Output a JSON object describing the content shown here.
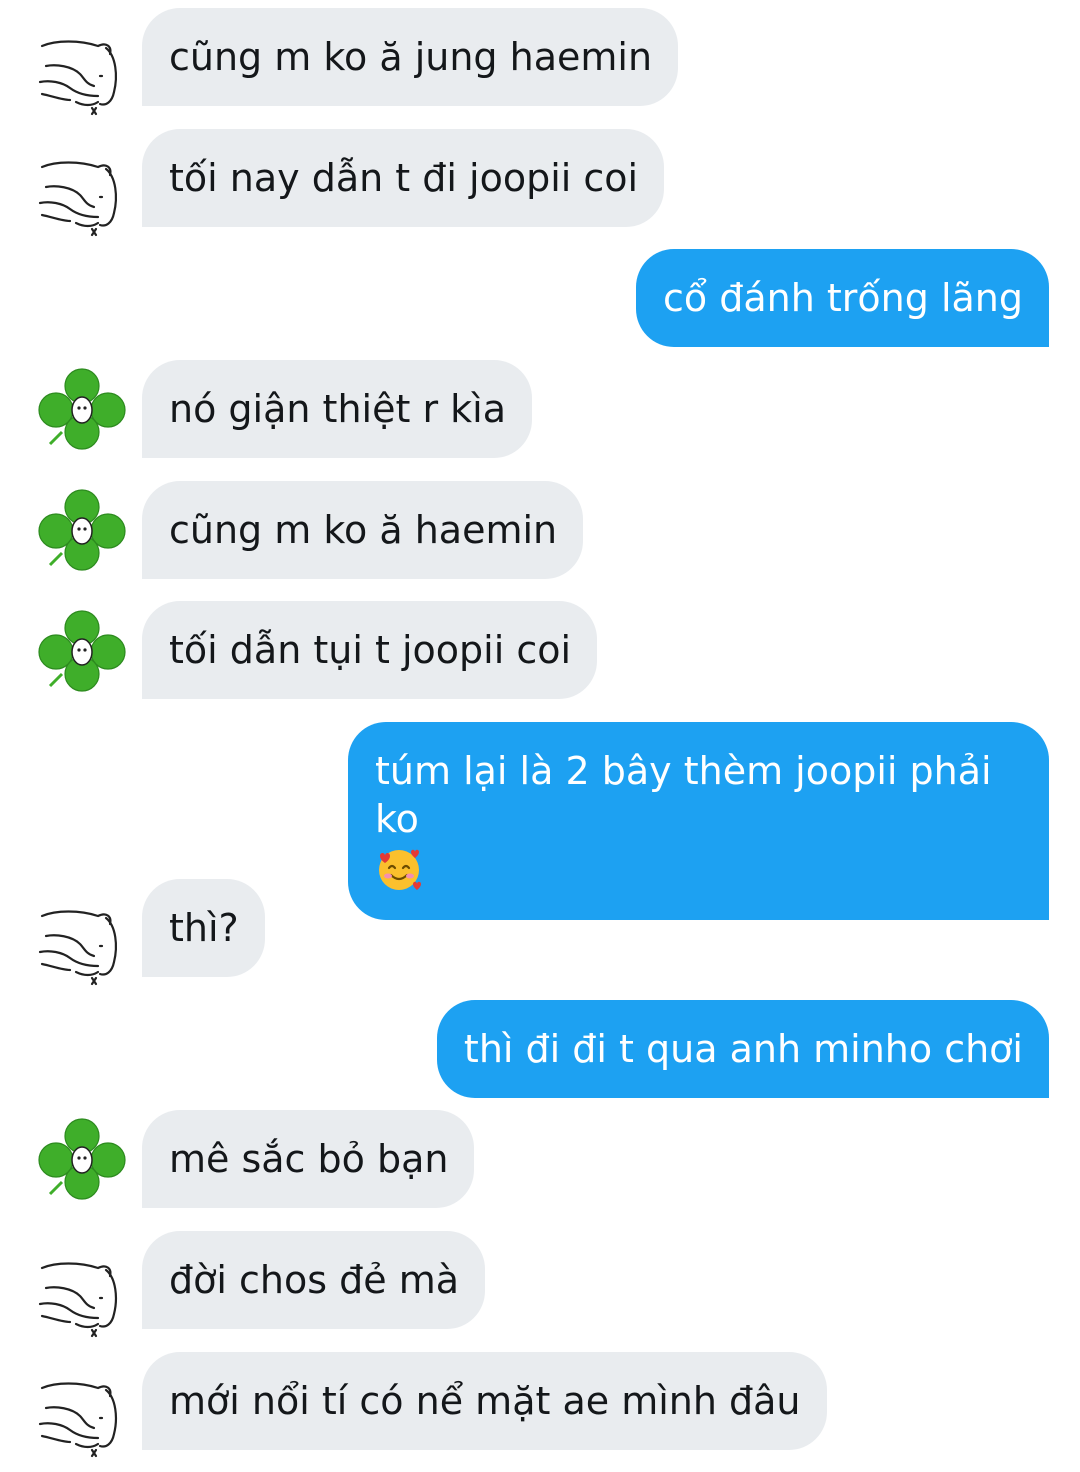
{
  "messages": [
    {
      "side": "in",
      "avatar": "sketch-cat-avatar",
      "text": "cũng m ko ă jung haemin"
    },
    {
      "side": "in",
      "avatar": "sketch-cat-avatar",
      "text": "tối nay dẫn t đi joopii coi"
    },
    {
      "side": "out",
      "text": "cổ đánh trống lãng"
    },
    {
      "side": "in",
      "avatar": "clover-avatar",
      "text": "nó giận thiệt r kìa"
    },
    {
      "side": "in",
      "avatar": "clover-avatar",
      "text": "cũng m ko ă haemin"
    },
    {
      "side": "in",
      "avatar": "clover-avatar",
      "text": "tối dẫn tụi t joopii coi"
    },
    {
      "side": "out",
      "text": "túm lại là 2 bây thèm joopii phải ko",
      "emoji": "smiling-face-with-hearts"
    },
    {
      "side": "in",
      "avatar": "sketch-cat-avatar",
      "text": "thì?"
    },
    {
      "side": "out",
      "text": "thì đi đi t qua anh minho chơi"
    },
    {
      "side": "in",
      "avatar": "clover-avatar",
      "text": "mê sắc bỏ bạn"
    },
    {
      "side": "in",
      "avatar": "sketch-cat-avatar",
      "text": "đời chos đẻ mà"
    },
    {
      "side": "in",
      "avatar": "sketch-cat-avatar",
      "text": "mới nổi tí có nể mặt ae mình đâu"
    }
  ],
  "colors": {
    "incoming_bubble": "#e9ecef",
    "outgoing_bubble": "#1da1f2",
    "incoming_text": "#14171a",
    "outgoing_text": "#ffffff",
    "clover_green": "#3fae2a"
  }
}
